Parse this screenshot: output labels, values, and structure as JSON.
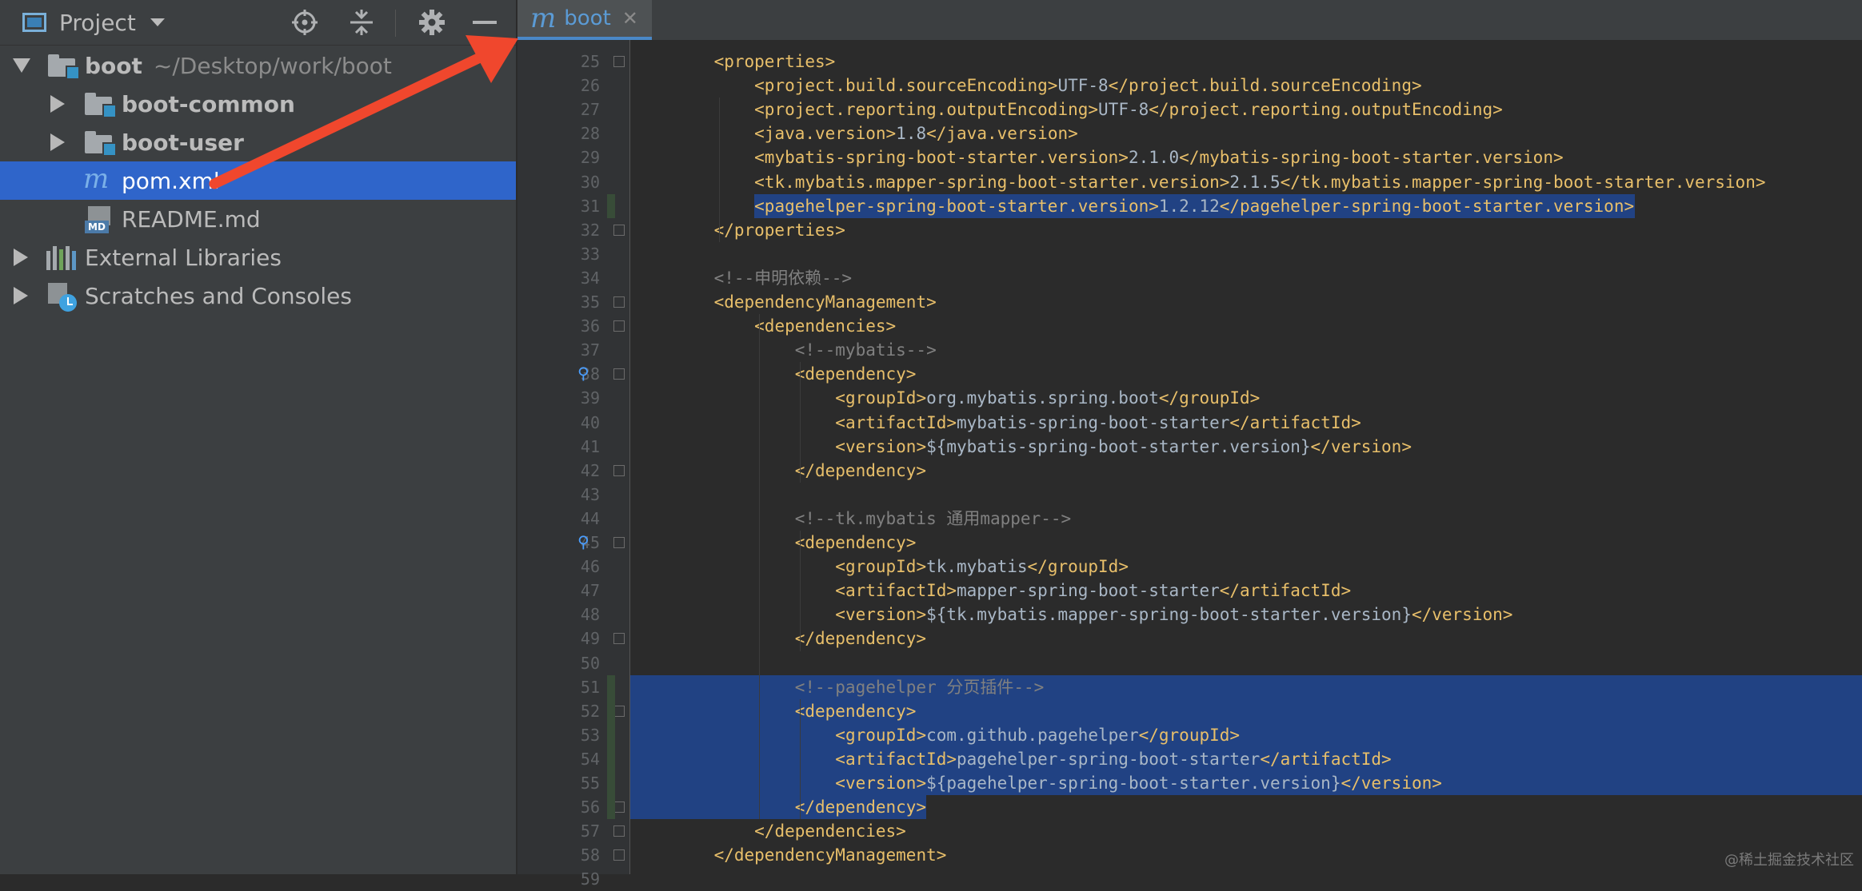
{
  "project_panel": {
    "title": "Project",
    "tree": [
      {
        "label": "boot",
        "path": "~/Desktop/work/boot"
      },
      {
        "label": "boot-common"
      },
      {
        "label": "boot-user"
      },
      {
        "label": "pom.xml"
      },
      {
        "label": "README.md"
      },
      {
        "label": "External Libraries"
      },
      {
        "label": "Scratches and Consoles"
      }
    ]
  },
  "editor": {
    "tab_label": "boot",
    "lines": [
      {
        "n": "25",
        "text": "    <properties>"
      },
      {
        "n": "26",
        "text": "        <project.build.sourceEncoding>UTF-8</project.build.sourceEncoding>"
      },
      {
        "n": "27",
        "text": "        <project.reporting.outputEncoding>UTF-8</project.reporting.outputEncoding>"
      },
      {
        "n": "28",
        "text": "        <java.version>1.8</java.version>"
      },
      {
        "n": "29",
        "text": "        <mybatis-spring-boot-starter.version>2.1.0</mybatis-spring-boot-starter.version>"
      },
      {
        "n": "30",
        "text": "        <tk.mybatis.mapper-spring-boot-starter.version>2.1.5</tk.mybatis.mapper-spring-boot-starter.version>"
      },
      {
        "n": "31",
        "text": "        <pagehelper-spring-boot-starter.version>1.2.12</pagehelper-spring-boot-starter.version>"
      },
      {
        "n": "32",
        "text": "    </properties>"
      },
      {
        "n": "33",
        "text": ""
      },
      {
        "n": "34",
        "text": "    <!--申明依赖-->"
      },
      {
        "n": "35",
        "text": "    <dependencyManagement>"
      },
      {
        "n": "36",
        "text": "        <dependencies>"
      },
      {
        "n": "37",
        "text": "            <!--mybatis-->"
      },
      {
        "n": "38",
        "text": "            <dependency>"
      },
      {
        "n": "39",
        "text": "                <groupId>org.mybatis.spring.boot</groupId>"
      },
      {
        "n": "40",
        "text": "                <artifactId>mybatis-spring-boot-starter</artifactId>"
      },
      {
        "n": "41",
        "text": "                <version>${mybatis-spring-boot-starter.version}</version>"
      },
      {
        "n": "42",
        "text": "            </dependency>"
      },
      {
        "n": "43",
        "text": ""
      },
      {
        "n": "44",
        "text": "            <!--tk.mybatis 通用mapper-->"
      },
      {
        "n": "45",
        "text": "            <dependency>"
      },
      {
        "n": "46",
        "text": "                <groupId>tk.mybatis</groupId>"
      },
      {
        "n": "47",
        "text": "                <artifactId>mapper-spring-boot-starter</artifactId>"
      },
      {
        "n": "48",
        "text": "                <version>${tk.mybatis.mapper-spring-boot-starter.version}</version>"
      },
      {
        "n": "49",
        "text": "            </dependency>"
      },
      {
        "n": "50",
        "text": ""
      },
      {
        "n": "51",
        "text": "            <!--pagehelper 分页插件-->"
      },
      {
        "n": "52",
        "text": "            <dependency>"
      },
      {
        "n": "53",
        "text": "                <groupId>com.github.pagehelper</groupId>"
      },
      {
        "n": "54",
        "text": "                <artifactId>pagehelper-spring-boot-starter</artifactId>"
      },
      {
        "n": "55",
        "text": "                <version>${pagehelper-spring-boot-starter.version}</version>"
      },
      {
        "n": "56",
        "text": "            </dependency>"
      },
      {
        "n": "57",
        "text": "        </dependencies>"
      },
      {
        "n": "58",
        "text": "    </dependencyManagement>"
      },
      {
        "n": "59",
        "text": ""
      }
    ]
  },
  "watermark": "@稀土掘金技术社区",
  "colors": {
    "panel_bg": "#3c3f41",
    "editor_bg": "#2b2b2b",
    "selection": "#214283",
    "tree_selection": "#2f65ca",
    "xml_tag": "#e8bf6a",
    "comment": "#808080",
    "annotation_arrow": "#f0472d"
  }
}
